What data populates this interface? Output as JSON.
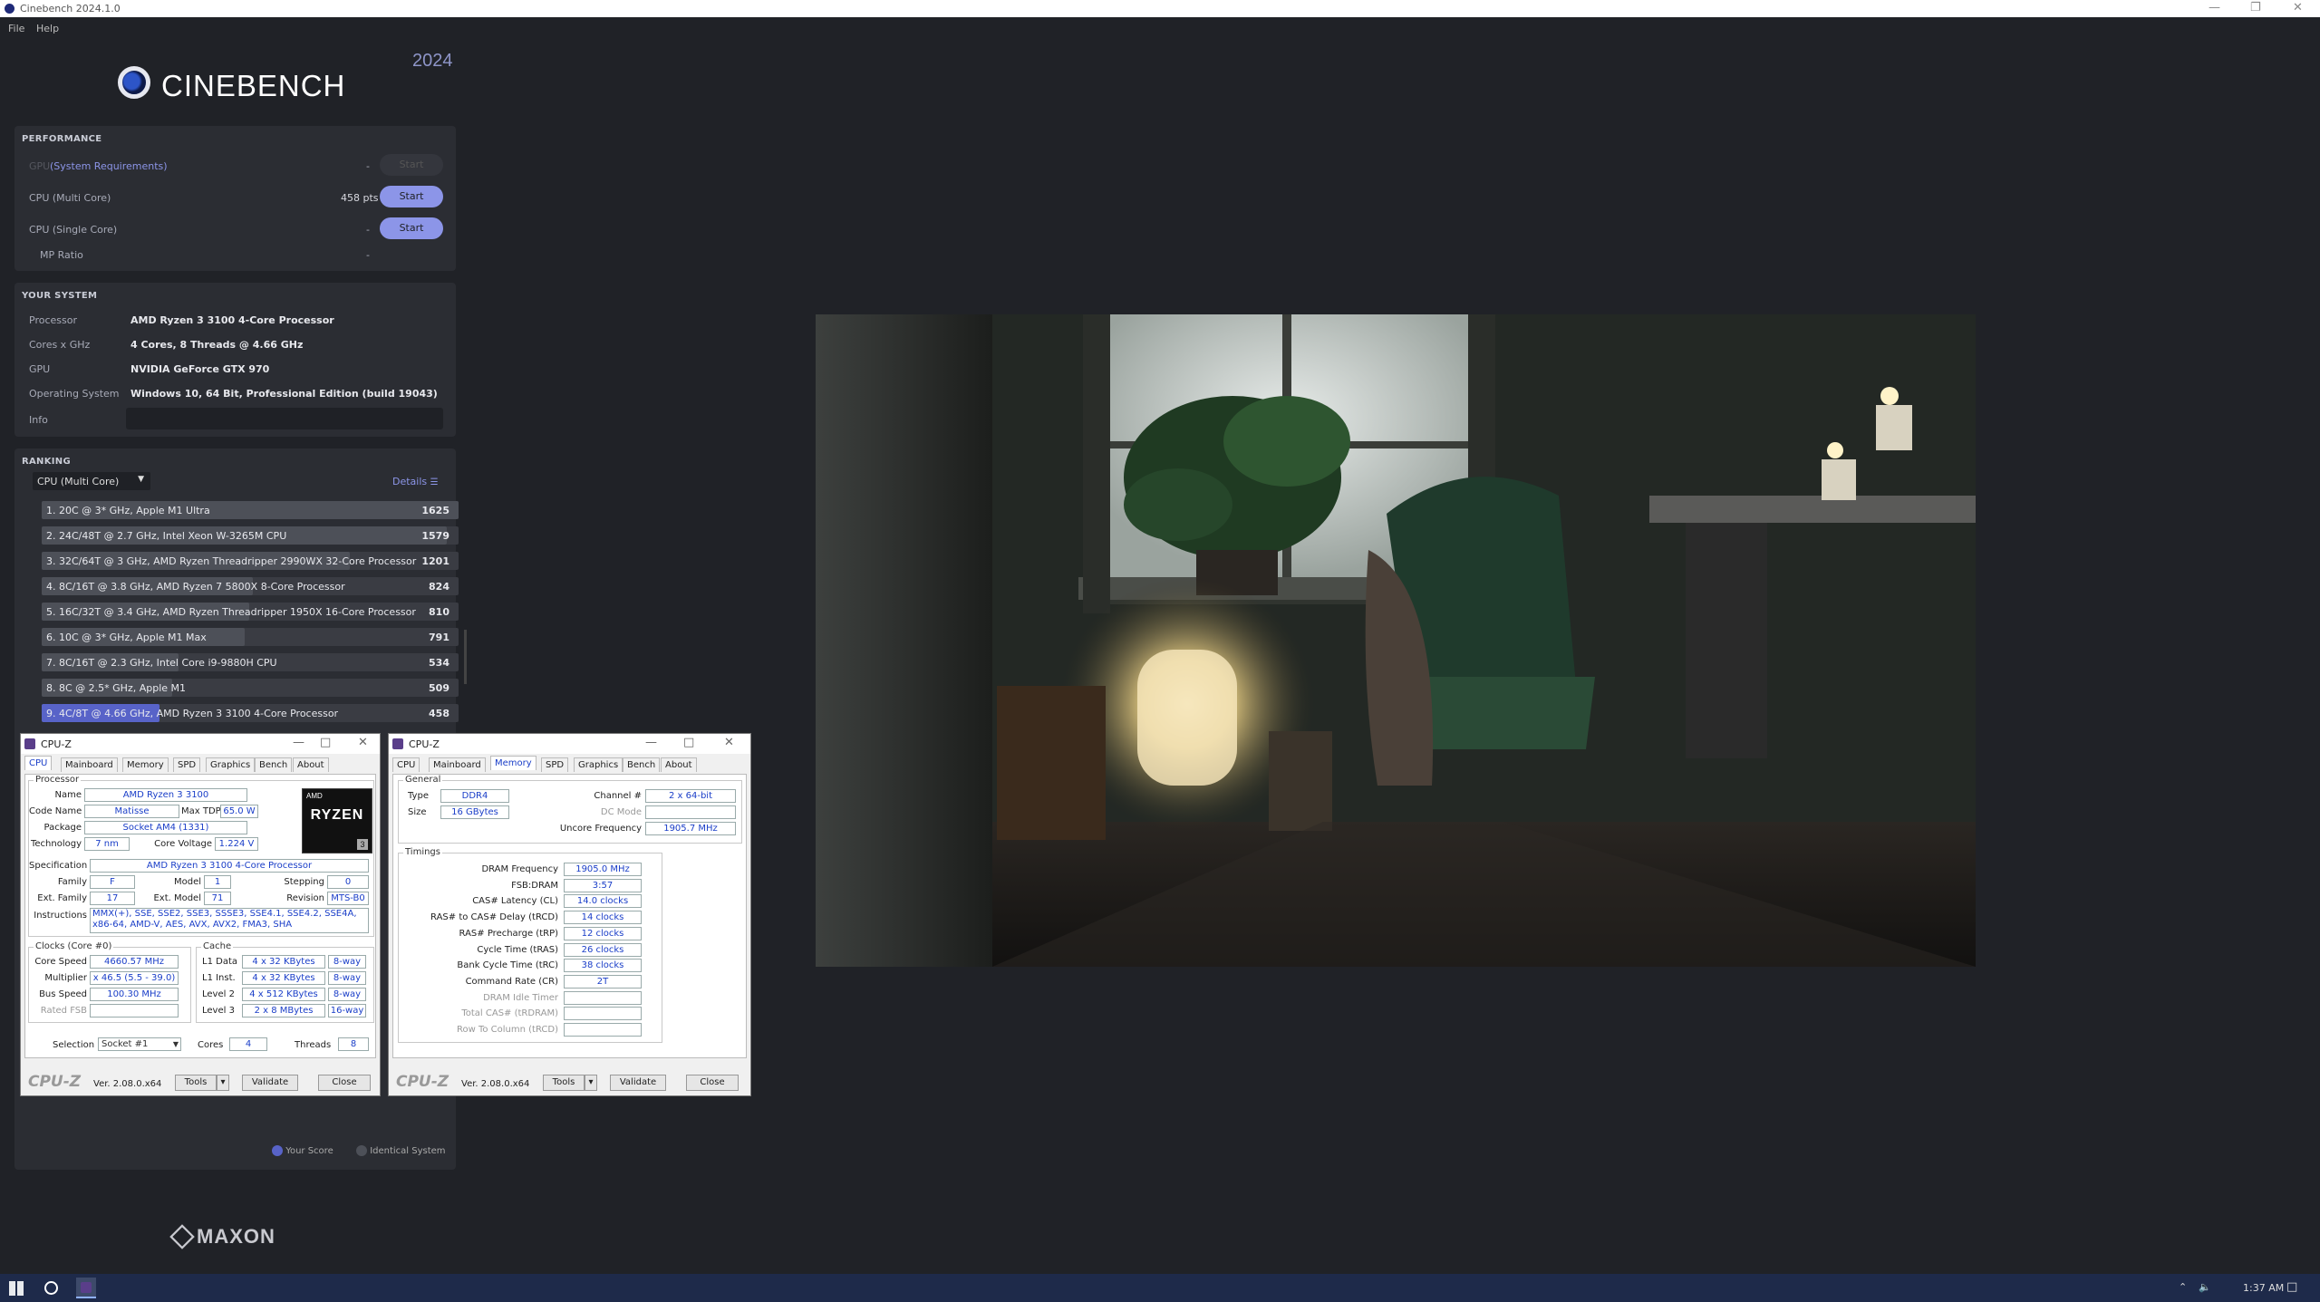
{
  "window": {
    "title": "Cinebench 2024.1.0"
  },
  "menu": [
    "File",
    "Help"
  ],
  "brand": {
    "name": "CINEBENCH",
    "year": "2024"
  },
  "performance": {
    "heading": "PERFORMANCE",
    "gpu": {
      "label": "GPU",
      "link": "(System Requirements)",
      "score": "-",
      "button": "Start"
    },
    "multi": {
      "label": "CPU (Multi Core)",
      "score": "458 pts",
      "button": "Start"
    },
    "single": {
      "label": "CPU (Single Core)",
      "score": "-",
      "button": "Start"
    },
    "mp": {
      "label": "MP Ratio",
      "score": "-"
    }
  },
  "system": {
    "heading": "YOUR SYSTEM",
    "rows": [
      {
        "label": "Processor",
        "value": "AMD Ryzen 3 3100 4-Core Processor"
      },
      {
        "label": "Cores x GHz",
        "value": "4 Cores, 8 Threads @ 4.66 GHz"
      },
      {
        "label": "GPU",
        "value": "NVIDIA GeForce GTX 970"
      },
      {
        "label": "Operating System",
        "value": "Windows 10, 64 Bit, Professional Edition (build 19043)"
      },
      {
        "label": "Info",
        "value": ""
      }
    ]
  },
  "ranking": {
    "heading": "RANKING",
    "dropdown": "CPU (Multi Core)",
    "details": "Details",
    "max": 1625,
    "items": [
      {
        "name": "1. 20C @ 3* GHz, Apple M1 Ultra",
        "score": 1625
      },
      {
        "name": "2. 24C/48T @ 2.7 GHz, Intel Xeon W-3265M CPU",
        "score": 1579
      },
      {
        "name": "3. 32C/64T @ 3 GHz, AMD Ryzen Threadripper 2990WX 32-Core Processor",
        "score": 1201
      },
      {
        "name": "4. 8C/16T @ 3.8 GHz, AMD Ryzen 7 5800X 8-Core Processor",
        "score": 824
      },
      {
        "name": "5. 16C/32T @ 3.4 GHz, AMD Ryzen Threadripper 1950X 16-Core Processor",
        "score": 810
      },
      {
        "name": "6. 10C @ 3* GHz, Apple M1 Max",
        "score": 791
      },
      {
        "name": "7. 8C/16T @ 2.3 GHz, Intel Core i9-9880H CPU",
        "score": 534
      },
      {
        "name": "8. 8C @ 2.5* GHz, Apple M1",
        "score": 509
      },
      {
        "name": "9. 4C/8T @ 4.66 GHz, AMD Ryzen 3 3100 4-Core Processor",
        "score": 458,
        "mine": true
      }
    ],
    "legend": {
      "your": "Your Score",
      "identical": "Identical System"
    }
  },
  "maxon": "MAXON",
  "cpuz_cpu": {
    "title": "CPU-Z",
    "tabs": [
      "CPU",
      "Mainboard",
      "Memory",
      "SPD",
      "Graphics",
      "Bench",
      "About"
    ],
    "processor": {
      "heading": "Processor",
      "name_l": "Name",
      "name": "AMD Ryzen 3 3100",
      "code_l": "Code Name",
      "code": "Matisse",
      "tdp_l": "Max TDP",
      "tdp": "65.0 W",
      "pkg_l": "Package",
      "pkg": "Socket AM4 (1331)",
      "tech_l": "Technology",
      "tech": "7 nm",
      "volt_l": "Core Voltage",
      "volt": "1.224 V",
      "spec_l": "Specification",
      "spec": "AMD Ryzen 3 3100 4-Core Processor",
      "fam_l": "Family",
      "fam": "F",
      "model_l": "Model",
      "model": "1",
      "step_l": "Stepping",
      "step": "0",
      "efam_l": "Ext. Family",
      "efam": "17",
      "emodel_l": "Ext. Model",
      "emodel": "71",
      "rev_l": "Revision",
      "rev": "MTS-B0",
      "instr_l": "Instructions",
      "instr": "MMX(+), SSE, SSE2, SSE3, SSSE3, SSE4.1, SSE4.2, SSE4A, x86-64, AMD-V, AES, AVX, AVX2, FMA3, SHA"
    },
    "logo": {
      "top": "AMD",
      "main": "RYZEN",
      "tier": "3"
    },
    "clocks": {
      "heading": "Clocks (Core #0)",
      "speed_l": "Core Speed",
      "speed": "4660.57 MHz",
      "mult_l": "Multiplier",
      "mult": "x 46.5 (5.5 - 39.0)",
      "bus_l": "Bus Speed",
      "bus": "100.30 MHz",
      "fsb_l": "Rated FSB",
      "fsb": ""
    },
    "cache": {
      "heading": "Cache",
      "l1d_l": "L1 Data",
      "l1d": "4 x 32 KBytes",
      "l1d_w": "8-way",
      "l1i_l": "L1 Inst.",
      "l1i": "4 x 32 KBytes",
      "l1i_w": "8-way",
      "l2_l": "Level 2",
      "l2": "4 x 512 KBytes",
      "l2_w": "8-way",
      "l3_l": "Level 3",
      "l3": "2 x 8 MBytes",
      "l3_w": "16-way"
    },
    "sel_l": "Selection",
    "sel": "Socket #1",
    "cores_l": "Cores",
    "cores": "4",
    "threads_l": "Threads",
    "threads": "8",
    "brand": "CPU-Z",
    "ver": "Ver. 2.08.0.x64",
    "tools": "Tools",
    "validate": "Validate",
    "close": "Close"
  },
  "cpuz_mem": {
    "title": "CPU-Z",
    "tabs": [
      "CPU",
      "Mainboard",
      "Memory",
      "SPD",
      "Graphics",
      "Bench",
      "About"
    ],
    "general": {
      "heading": "General",
      "type_l": "Type",
      "type": "DDR4",
      "size_l": "Size",
      "size": "16 GBytes",
      "chan_l": "Channel #",
      "chan": "2 x 64-bit",
      "dc_l": "DC Mode",
      "dc": "",
      "unc_l": "Uncore Frequency",
      "unc": "1905.7 MHz"
    },
    "timings": {
      "heading": "Timings",
      "rows": [
        {
          "label": "DRAM Frequency",
          "value": "1905.0 MHz"
        },
        {
          "label": "FSB:DRAM",
          "value": "3:57"
        },
        {
          "label": "CAS# Latency (CL)",
          "value": "14.0 clocks"
        },
        {
          "label": "RAS# to CAS# Delay (tRCD)",
          "value": "14 clocks"
        },
        {
          "label": "RAS# Precharge (tRP)",
          "value": "12 clocks"
        },
        {
          "label": "Cycle Time (tRAS)",
          "value": "26 clocks"
        },
        {
          "label": "Bank Cycle Time (tRC)",
          "value": "38 clocks"
        },
        {
          "label": "Command Rate (CR)",
          "value": "2T"
        },
        {
          "label": "DRAM Idle Timer",
          "value": ""
        },
        {
          "label": "Total CAS# (tRDRAM)",
          "value": ""
        },
        {
          "label": "Row To Column (tRCD)",
          "value": ""
        }
      ]
    },
    "brand": "CPU-Z",
    "ver": "Ver. 2.08.0.x64",
    "tools": "Tools",
    "validate": "Validate",
    "close": "Close"
  },
  "taskbar": {
    "time": "1:37 AM"
  }
}
